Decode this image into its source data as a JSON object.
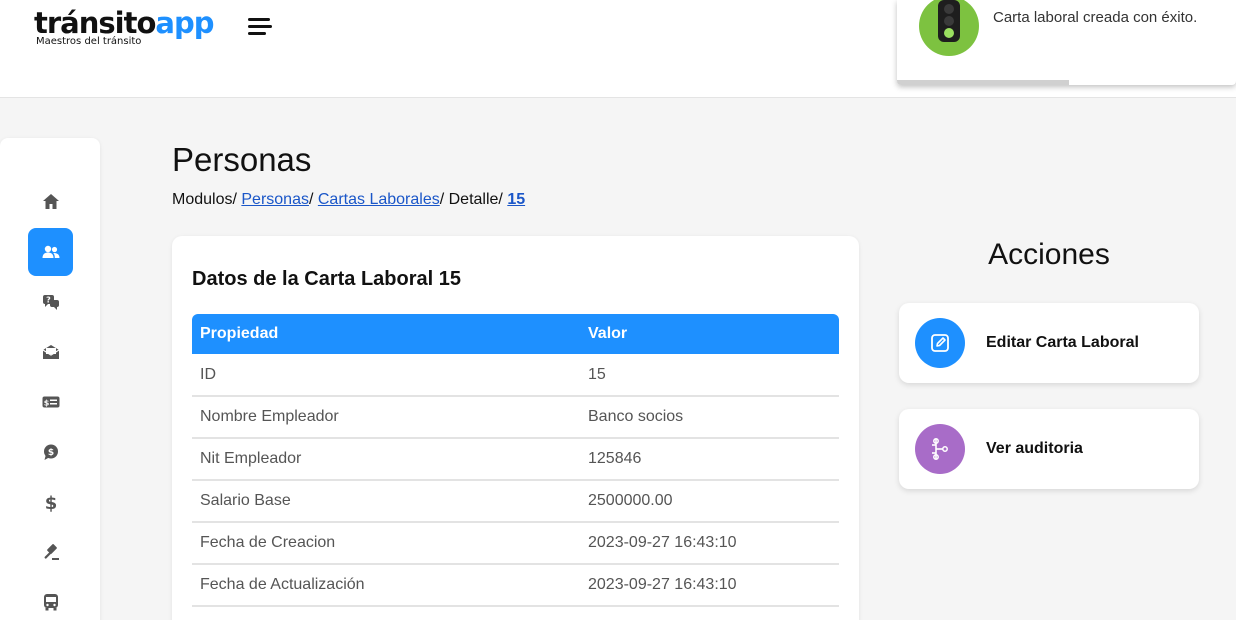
{
  "header": {
    "logo_part1": "tránsito",
    "logo_part2": "app",
    "logo_tagline": "Maestros del tránsito"
  },
  "toast": {
    "message": "Carta laboral creada con éxito."
  },
  "sidebar": {
    "items": [
      {
        "icon": "home-icon",
        "active": false
      },
      {
        "icon": "users-icon",
        "active": true
      },
      {
        "icon": "chat-question-icon",
        "active": false
      },
      {
        "icon": "mail-open-icon",
        "active": false
      },
      {
        "icon": "money-card-icon",
        "active": false
      },
      {
        "icon": "dollar-chat-icon",
        "active": false
      },
      {
        "icon": "dollar-icon",
        "active": false
      },
      {
        "icon": "gavel-icon",
        "active": false
      },
      {
        "icon": "bus-icon",
        "active": false
      }
    ]
  },
  "main": {
    "title": "Personas",
    "breadcrumb": {
      "modulos": "Modulos/",
      "sep": "/",
      "personas": "Personas",
      "cartas": "Cartas Laborales",
      "detalle": "/ Detalle/",
      "id": "15"
    },
    "card": {
      "title": "Datos de la Carta Laboral 15",
      "headers": [
        "Propiedad",
        "Valor"
      ],
      "rows": [
        {
          "property": "ID",
          "value": "15"
        },
        {
          "property": "Nombre Empleador",
          "value": "Banco socios"
        },
        {
          "property": "Nit Empleador",
          "value": "125846"
        },
        {
          "property": "Salario Base",
          "value": "2500000.00"
        },
        {
          "property": "Fecha de Creacion",
          "value": "2023-09-27 16:43:10"
        },
        {
          "property": "Fecha de Actualización",
          "value": "2023-09-27 16:43:10"
        }
      ]
    }
  },
  "actions": {
    "title": "Acciones",
    "items": [
      {
        "label": "Editar Carta Laboral",
        "icon": "edit-icon",
        "color": "#1e90ff"
      },
      {
        "label": "Ver auditoria",
        "icon": "audit-tree-icon",
        "color": "#a86cc8"
      }
    ]
  },
  "colors": {
    "accent": "#1e90ff",
    "success": "#7dc240",
    "audit": "#a86cc8"
  }
}
